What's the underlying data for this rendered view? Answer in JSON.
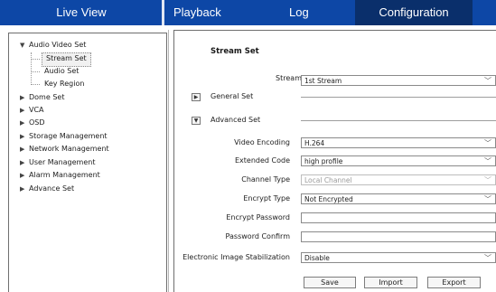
{
  "nav": {
    "tabs": [
      {
        "label": "Live View",
        "active": false
      },
      {
        "label": "Playback",
        "active": false
      },
      {
        "label": "Log",
        "active": false
      },
      {
        "label": "Configuration",
        "active": true
      }
    ],
    "colors": {
      "bar": "#0d47a6",
      "active": "#0a2f6b"
    }
  },
  "sidebar": {
    "tree": [
      {
        "label": "Audio Video Set",
        "expanded": true,
        "icon": "triangle-down-icon",
        "children": [
          "Stream Set",
          "Audio Set",
          "Key Region"
        ],
        "selected_child": "Stream Set"
      },
      {
        "label": "Dome Set",
        "expanded": false,
        "icon": "triangle-right-icon"
      },
      {
        "label": "VCA",
        "expanded": false,
        "icon": "triangle-right-icon"
      },
      {
        "label": "OSD",
        "expanded": false,
        "icon": "triangle-right-icon"
      },
      {
        "label": "Storage Management",
        "expanded": false,
        "icon": "triangle-right-icon"
      },
      {
        "label": "Network Management",
        "expanded": false,
        "icon": "triangle-right-icon"
      },
      {
        "label": "User Management",
        "expanded": false,
        "icon": "triangle-right-icon"
      },
      {
        "label": "Alarm Management",
        "expanded": false,
        "icon": "triangle-right-icon"
      },
      {
        "label": "Advance Set",
        "expanded": false,
        "icon": "triangle-right-icon"
      }
    ]
  },
  "main": {
    "title": "Stream Set",
    "stream": {
      "label": "Stream",
      "value": "1st Stream"
    },
    "general_set": {
      "label": "General Set",
      "expanded": false,
      "icon": "expand-right-icon"
    },
    "advanced_set": {
      "label": "Advanced Set",
      "expanded": true,
      "icon": "expand-down-icon"
    },
    "fields": {
      "video_encoding": {
        "label": "Video Encoding",
        "value": "H.264"
      },
      "extended_code": {
        "label": "Extended Code",
        "value": "high profile"
      },
      "channel_type": {
        "label": "Channel Type",
        "value": "Local Channel",
        "disabled": true
      },
      "encrypt_type": {
        "label": "Encrypt Type",
        "value": "Not Encrypted"
      },
      "encrypt_password": {
        "label": "Encrypt Password",
        "value": ""
      },
      "password_confirm": {
        "label": "Password Confirm",
        "value": ""
      },
      "eis": {
        "label": "Electronic Image Stabilization",
        "value": "Disable"
      }
    },
    "buttons": {
      "save": "Save",
      "import": "Import",
      "export": "Export"
    }
  }
}
